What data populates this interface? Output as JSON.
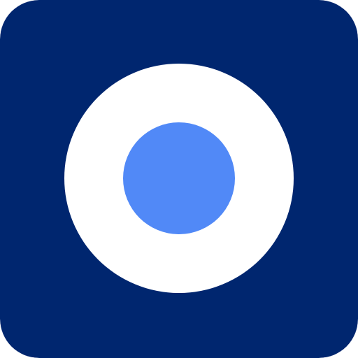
{
  "icon": {
    "name": "record-icon",
    "colors": {
      "background": "#00266f",
      "outer_ring": "#ffffff",
      "inner_dot": "#5189f7"
    }
  }
}
